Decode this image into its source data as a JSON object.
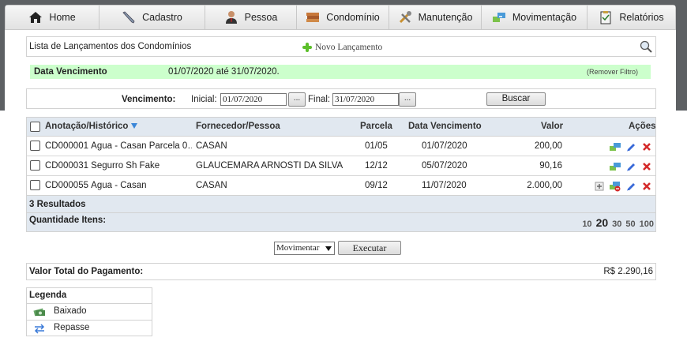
{
  "nav": [
    {
      "label": "Home",
      "icon": "home-icon"
    },
    {
      "label": "Cadastro",
      "icon": "pencil-icon"
    },
    {
      "label": "Pessoa",
      "icon": "person-icon"
    },
    {
      "label": "Condomínio",
      "icon": "books-icon"
    },
    {
      "label": "Manutenção",
      "icon": "tools-icon"
    },
    {
      "label": "Movimentação",
      "icon": "transfer-icon"
    },
    {
      "label": "Relatórios",
      "icon": "report-icon"
    }
  ],
  "list": {
    "title": "Lista de Lançamentos dos Condomínios",
    "new_label": "Novo Lançamento"
  },
  "filter": {
    "label": "Data Vencimento",
    "value": "01/07/2020 até 31/07/2020.",
    "remove_label": "(Remover Filtro)"
  },
  "search_form": {
    "vencimento_label": "Vencimento:",
    "inicial_label": "Inicial:",
    "inicial_value": "01/07/2020",
    "final_label": "Final:",
    "final_value": "31/07/2020",
    "dots_label": "...",
    "buscar_label": "Buscar"
  },
  "table": {
    "columns": [
      "Anotação/Histórico",
      "Fornecedor/Pessoa",
      "Parcela",
      "Data Vencimento",
      "Valor",
      "Ações"
    ],
    "rows": [
      {
        "historico": "CD000001 Água - Casan Parcela 0…",
        "fornecedor": "CASAN",
        "parcela": "01/05",
        "vencimento": "01/07/2020",
        "valor": "200,00",
        "extra_action": false
      },
      {
        "historico": "CD000031 Segurro Sh Fake",
        "fornecedor": "GLAUCEMARA ARNOSTI DA SILVA",
        "parcela": "12/12",
        "vencimento": "05/07/2020",
        "valor": "90,16",
        "extra_action": false
      },
      {
        "historico": "CD000055 Água - Casan",
        "fornecedor": "CASAN",
        "parcela": "09/12",
        "vencimento": "11/07/2020",
        "valor": "2.000,00",
        "extra_action": true
      }
    ],
    "results": "3 Resultados",
    "qty_label": "Quantidade Itens:",
    "page_sizes": [
      "10",
      "20",
      "30",
      "50",
      "100"
    ],
    "current_page_size": "20"
  },
  "bulk": {
    "select_value": "Movimentar",
    "execute_label": "Executar"
  },
  "total": {
    "label": "Valor Total do Pagamento:",
    "value": "R$ 2.290,16"
  },
  "legend": {
    "title": "Legenda",
    "items": [
      {
        "label": "Baixado",
        "icon": "money-icon"
      },
      {
        "label": "Repasse",
        "icon": "repasse-arrows-icon"
      }
    ]
  },
  "colors": {
    "filter_bg": "#ccffcc",
    "grid_header_bg": "#e1e8f0",
    "delete_red": "#d42a2a",
    "edit_blue": "#2a5bd4"
  }
}
